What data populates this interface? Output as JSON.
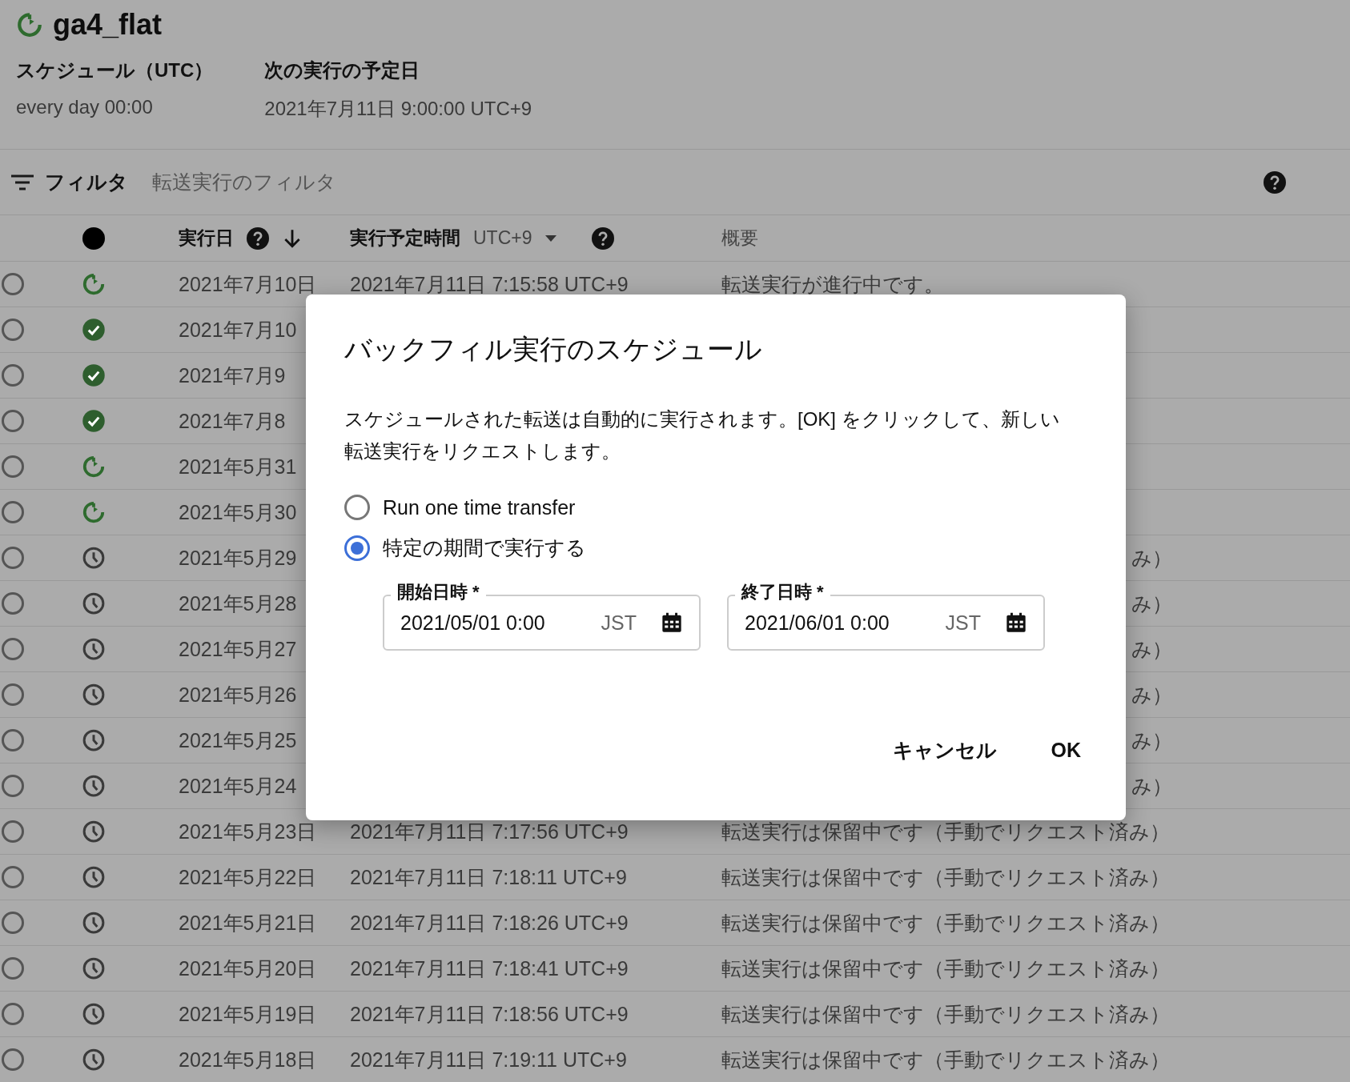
{
  "transfer": {
    "name": "ga4_flat"
  },
  "schedule": {
    "label": "スケジュール（UTC）",
    "value": "every day 00:00"
  },
  "next_run": {
    "label": "次の実行の予定日",
    "value": "2021年7月11日 9:00:00 UTC+9"
  },
  "filter": {
    "label": "フィルタ",
    "placeholder": "転送実行のフィルタ"
  },
  "table": {
    "date_column": {
      "label": "実行日"
    },
    "time_column": {
      "label": "実行予定時間",
      "timezone": "UTC+9"
    },
    "summary_column": {
      "label": "概要"
    },
    "rows": [
      {
        "selected": false,
        "kind": "running",
        "date": "2021年7月10日",
        "time": "2021年7月11日 7:15:58 UTC+9",
        "summary": "転送実行が進行中です。"
      },
      {
        "selected": false,
        "kind": "succeeded",
        "date": "2021年7月10"
      },
      {
        "selected": false,
        "kind": "succeeded",
        "date": "2021年7月9"
      },
      {
        "selected": false,
        "kind": "succeeded",
        "date": "2021年7月8"
      },
      {
        "selected": false,
        "kind": "running",
        "date": "2021年5月31"
      },
      {
        "selected": false,
        "kind": "running",
        "date": "2021年5月30"
      },
      {
        "selected": false,
        "kind": "pending",
        "date": "2021年5月29",
        "summary_end": "み）"
      },
      {
        "selected": false,
        "kind": "pending",
        "date": "2021年5月28",
        "summary_end": "み）"
      },
      {
        "selected": false,
        "kind": "pending",
        "date": "2021年5月27",
        "summary_end": "み）"
      },
      {
        "selected": false,
        "kind": "pending",
        "date": "2021年5月26",
        "summary_end": "み）"
      },
      {
        "selected": false,
        "kind": "pending",
        "date": "2021年5月25",
        "summary_end": "み）"
      },
      {
        "selected": false,
        "kind": "pending",
        "date": "2021年5月24",
        "summary_end": "み）"
      },
      {
        "selected": false,
        "kind": "pending",
        "date": "2021年5月23日",
        "time": "2021年7月11日 7:17:56 UTC+9",
        "summary": "転送実行は保留中です（手動でリクエスト済み）"
      },
      {
        "selected": false,
        "kind": "pending",
        "date": "2021年5月22日",
        "time": "2021年7月11日 7:18:11 UTC+9",
        "summary": "転送実行は保留中です（手動でリクエスト済み）"
      },
      {
        "selected": false,
        "kind": "pending",
        "date": "2021年5月21日",
        "time": "2021年7月11日 7:18:26 UTC+9",
        "summary": "転送実行は保留中です（手動でリクエスト済み）"
      },
      {
        "selected": false,
        "kind": "pending",
        "date": "2021年5月20日",
        "time": "2021年7月11日 7:18:41 UTC+9",
        "summary": "転送実行は保留中です（手動でリクエスト済み）"
      },
      {
        "selected": false,
        "kind": "pending",
        "date": "2021年5月19日",
        "time": "2021年7月11日 7:18:56 UTC+9",
        "summary": "転送実行は保留中です（手動でリクエスト済み）"
      },
      {
        "selected": false,
        "kind": "pending",
        "date": "2021年5月18日",
        "time": "2021年7月11日 7:19:11 UTC+9",
        "summary": "転送実行は保留中です（手動でリクエスト済み）"
      }
    ]
  },
  "dialog": {
    "title": "バックフィル実行のスケジュール",
    "message": "スケジュールされた転送は自動的に実行されます。[OK] をクリックして、新しい転送実行をリクエストします。",
    "options": [
      {
        "label": "Run one time transfer",
        "selected": false
      },
      {
        "label": "特定の期間で実行する",
        "selected": true
      }
    ],
    "fields": [
      {
        "label": "開始日時 *",
        "value": "2021/05/01 0:00",
        "timezone": "JST"
      },
      {
        "label": "終了日時 *",
        "value": "2021/06/01 0:00",
        "timezone": "JST"
      }
    ],
    "buttons": [
      "キャンセル",
      "OK"
    ]
  }
}
